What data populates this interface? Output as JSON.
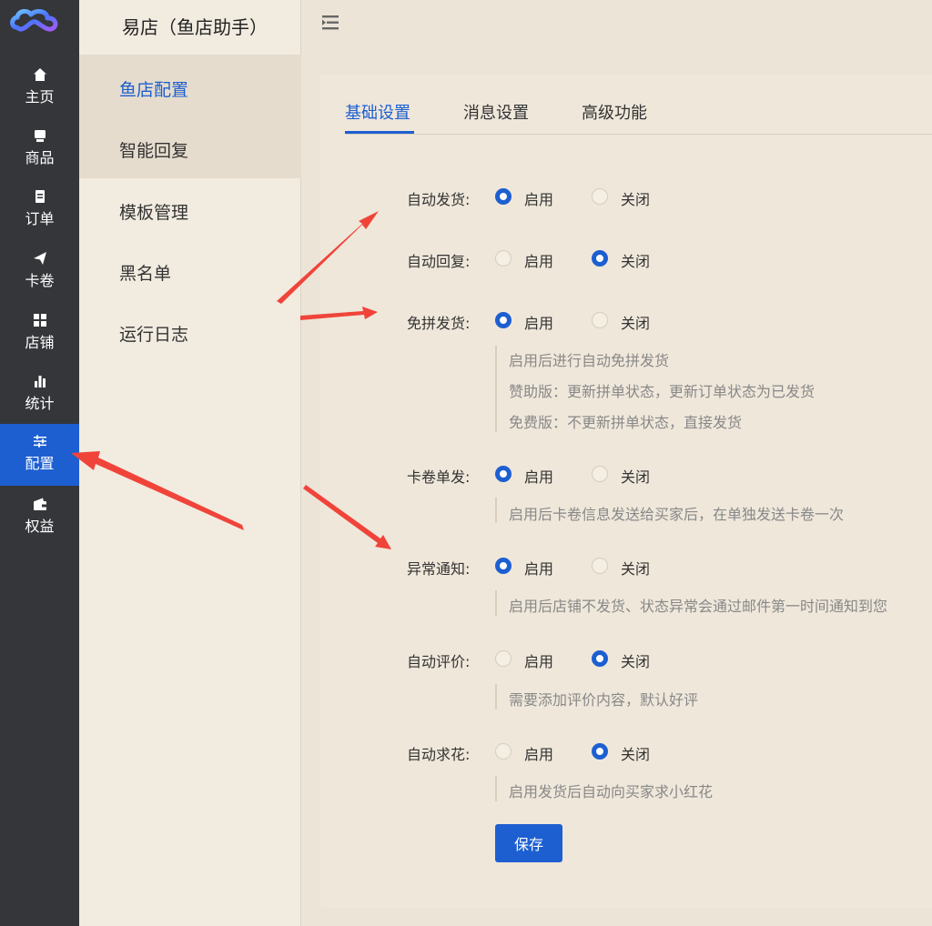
{
  "app": {
    "title": "易店（鱼店助手）"
  },
  "rail": {
    "items": [
      {
        "label": "主页",
        "icon": "home-icon"
      },
      {
        "label": "商品",
        "icon": "goods-icon"
      },
      {
        "label": "订单",
        "icon": "order-icon"
      },
      {
        "label": "卡卷",
        "icon": "send-icon"
      },
      {
        "label": "店铺",
        "icon": "grid-icon"
      },
      {
        "label": "统计",
        "icon": "bar-chart-icon"
      },
      {
        "label": "配置",
        "icon": "sliders-icon",
        "active": true
      },
      {
        "label": "权益",
        "icon": "wallet-icon"
      }
    ]
  },
  "subnav": {
    "items": [
      {
        "label": "鱼店配置",
        "active": true
      },
      {
        "label": "智能回复"
      },
      {
        "label": "模板管理"
      },
      {
        "label": "黑名单"
      },
      {
        "label": "运行日志"
      }
    ]
  },
  "tabs": [
    {
      "label": "基础设置",
      "active": true
    },
    {
      "label": "消息设置"
    },
    {
      "label": "高级功能"
    }
  ],
  "options": {
    "on": "启用",
    "off": "关闭"
  },
  "settings": [
    {
      "label": "自动发货:",
      "value": "启用",
      "hints": []
    },
    {
      "label": "自动回复:",
      "value": "关闭",
      "hints": []
    },
    {
      "label": "免拼发货:",
      "value": "启用",
      "hints": [
        "启用后进行自动免拼发货",
        "赞助版：更新拼单状态，更新订单状态为已发货",
        "免费版：不更新拼单状态，直接发货"
      ]
    },
    {
      "label": "卡卷单发:",
      "value": "启用",
      "hints": [
        "启用后卡卷信息发送给买家后，在单独发送卡卷一次"
      ]
    },
    {
      "label": "异常通知:",
      "value": "启用",
      "hints": [
        "启用后店铺不发货、状态异常会通过邮件第一时间通知到您"
      ]
    },
    {
      "label": "自动评价:",
      "value": "关闭",
      "hints": [
        "需要添加评价内容，默认好评"
      ]
    },
    {
      "label": "自动求花:",
      "value": "关闭",
      "hints": [
        "启用发货后自动向买家求小红花"
      ]
    }
  ],
  "save_label": "保存",
  "colors": {
    "accent": "#1d5fd1",
    "rail_bg": "#34363a",
    "arrow": "#f0443a"
  }
}
